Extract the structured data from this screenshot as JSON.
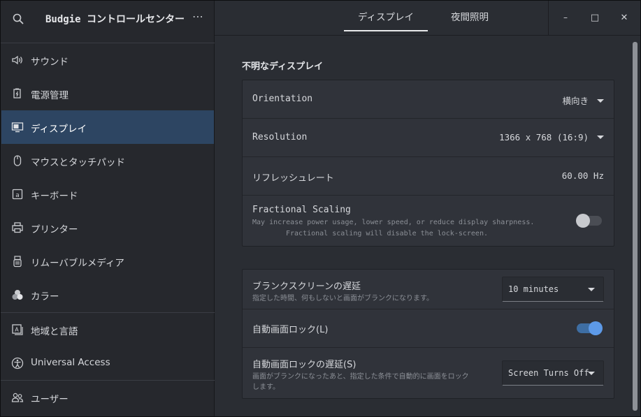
{
  "sidebar": {
    "title": "Budgie コントロールセンター",
    "more": "⋯",
    "items": [
      {
        "label": "サウンド",
        "icon": "speaker-icon"
      },
      {
        "label": "電源管理",
        "icon": "power-icon"
      },
      {
        "label": "ディスプレイ",
        "icon": "display-icon"
      },
      {
        "label": "マウスとタッチパッド",
        "icon": "mouse-icon"
      },
      {
        "label": "キーボード",
        "icon": "keyboard-icon"
      },
      {
        "label": "プリンター",
        "icon": "printer-icon"
      },
      {
        "label": "リムーバブルメディア",
        "icon": "removable-media-icon"
      },
      {
        "label": "カラー",
        "icon": "color-icon"
      },
      {
        "label": "地域と言語",
        "icon": "region-language-icon"
      },
      {
        "label": "Universal Access",
        "icon": "accessibility-icon"
      },
      {
        "label": "ユーザー",
        "icon": "users-icon"
      }
    ],
    "active_index": 2
  },
  "header": {
    "tabs": [
      {
        "label": "ディスプレイ",
        "active": true
      },
      {
        "label": "夜間照明",
        "active": false
      }
    ],
    "window_buttons": {
      "minimize": "–",
      "maximize": "□",
      "close": "✕"
    }
  },
  "display": {
    "section_title": "不明なディスプレイ",
    "orientation": {
      "label": "Orientation",
      "value": "横向き"
    },
    "resolution": {
      "label": "Resolution",
      "value": "1366 x 768 (16:9)"
    },
    "refresh": {
      "label": "リフレッシュレート",
      "value": "60.00 Hz"
    },
    "fractional": {
      "label": "Fractional Scaling",
      "desc1": "May increase power usage, lower speed, or reduce display sharpness.",
      "desc2": "Fractional scaling will disable the lock-screen.",
      "enabled": false
    }
  },
  "screen": {
    "blank": {
      "label": "ブランクスクリーンの遅延",
      "desc": "指定した時間、何もしないと画面がブランクになります。",
      "value": "10 minutes"
    },
    "autolock": {
      "label": "自動画面ロック(L)",
      "enabled": true
    },
    "lockdelay": {
      "label": "自動画面ロックの遅延(S)",
      "desc1": "画面がブランクになったあと、指定した条件で自動的に画面をロック",
      "desc2": "します。",
      "value": "Screen Turns Off"
    }
  },
  "colors": {
    "accent": "#5d9ae8",
    "active_row": "#2d4562"
  }
}
